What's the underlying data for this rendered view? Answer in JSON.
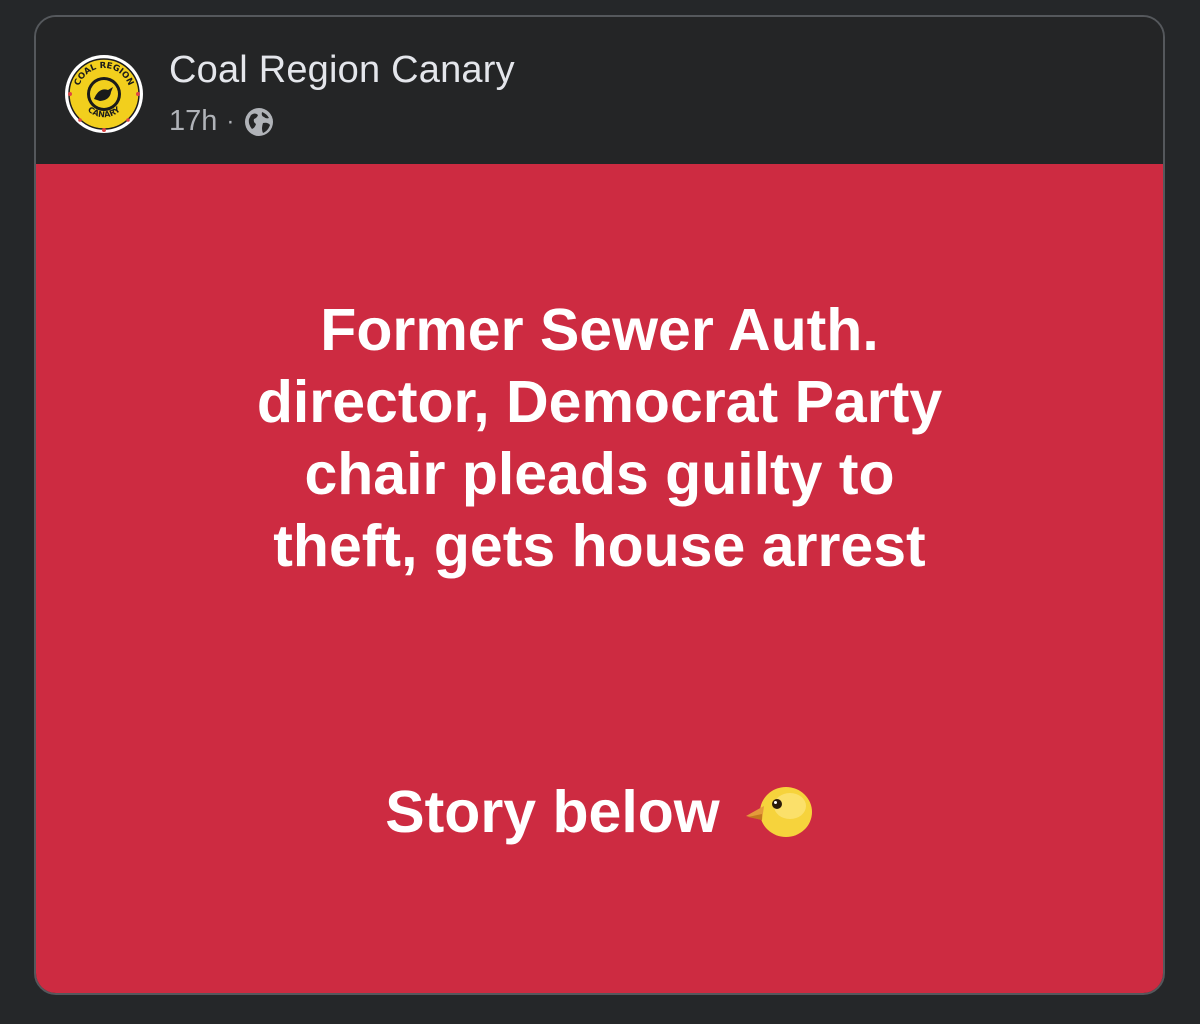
{
  "post": {
    "page_name": "Coal Region Canary",
    "time": "17h",
    "separator": "·",
    "privacy_icon": "globe-icon",
    "avatar_logo_text_top": "COAL REGION",
    "avatar_logo_text_bottom": "CANARY",
    "headline": "Former Sewer Auth.\ndirector, Democrat Party\nchair pleads guilty to\ntheft, gets house arrest",
    "story_text": "Story below",
    "story_emoji": "chick-icon"
  },
  "colors": {
    "background": "#252729",
    "card": "#242526",
    "post_background": "#cd2b41",
    "text_primary": "#e4e6eb",
    "text_secondary": "#b0b3b8"
  }
}
